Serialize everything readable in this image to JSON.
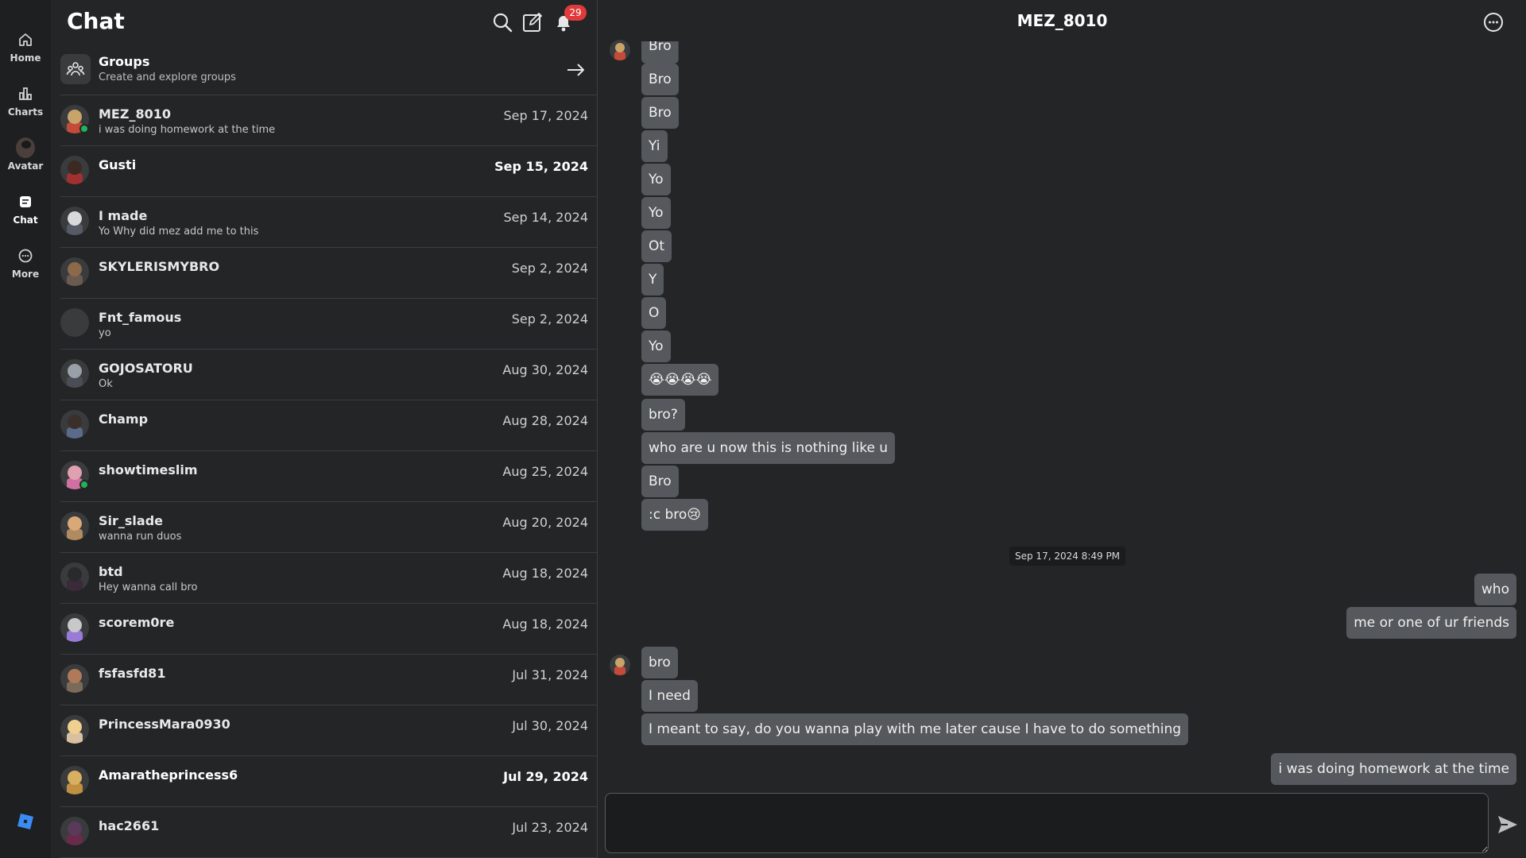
{
  "nav": {
    "items": [
      {
        "label": "Home",
        "icon": "home-icon"
      },
      {
        "label": "Charts",
        "icon": "bar-chart-icon"
      },
      {
        "label": "Avatar",
        "icon": "avatar-icon"
      },
      {
        "label": "Chat",
        "icon": "chat-icon"
      },
      {
        "label": "More",
        "icon": "more-circle-icon"
      }
    ]
  },
  "list": {
    "title": "Chat",
    "notification_count": "29",
    "groups": {
      "title": "Groups",
      "subtitle": "Create and explore groups"
    },
    "conversations": [
      {
        "name": "MEZ_8010",
        "preview": "i was doing homework at the time",
        "date": "Sep 17, 2024"
      },
      {
        "name": "Gusti",
        "preview": "",
        "date": "Sep 15, 2024"
      },
      {
        "name": "I made",
        "preview": "Yo Why did mez add me to this",
        "date": "Sep 14, 2024"
      },
      {
        "name": "SKYLERISMYBRO",
        "preview": "",
        "date": "Sep 2, 2024"
      },
      {
        "name": "Fnt_famous",
        "preview": "yo",
        "date": "Sep 2, 2024"
      },
      {
        "name": "GOJOSATORU",
        "preview": "Ok",
        "date": "Aug 30, 2024"
      },
      {
        "name": "Champ",
        "preview": "",
        "date": "Aug 28, 2024"
      },
      {
        "name": "showtimeslim",
        "preview": "",
        "date": "Aug 25, 2024"
      },
      {
        "name": "Sir_slade",
        "preview": "wanna run duos",
        "date": "Aug 20, 2024"
      },
      {
        "name": "btd",
        "preview": "Hey wanna call bro",
        "date": "Aug 18, 2024"
      },
      {
        "name": "scorem0re",
        "preview": "",
        "date": "Aug 18, 2024"
      },
      {
        "name": "fsfasfd81",
        "preview": "",
        "date": "Jul 31, 2024"
      },
      {
        "name": "PrincessMara0930",
        "preview": "",
        "date": "Jul 30, 2024"
      },
      {
        "name": "Amaratheprincess6",
        "preview": "",
        "date": "Jul 29, 2024"
      },
      {
        "name": "hac2661",
        "preview": "",
        "date": "Jul 23, 2024"
      }
    ]
  },
  "conversation": {
    "title": "MEZ_8010",
    "messages": [
      {
        "text": "Bro",
        "dir": "in"
      },
      {
        "text": "Bro",
        "dir": "in"
      },
      {
        "text": "Bro",
        "dir": "in"
      },
      {
        "text": "Yi",
        "dir": "in"
      },
      {
        "text": "Yo",
        "dir": "in"
      },
      {
        "text": "Yo",
        "dir": "in"
      },
      {
        "text": "Ot",
        "dir": "in"
      },
      {
        "text": "Y",
        "dir": "in"
      },
      {
        "text": "O",
        "dir": "in"
      },
      {
        "text": "Yo",
        "dir": "in"
      },
      {
        "text": "😭😭😭😭",
        "dir": "in"
      },
      {
        "text": "bro?",
        "dir": "in"
      },
      {
        "text": "who are u now this is nothing like u",
        "dir": "in"
      },
      {
        "text": "Bro",
        "dir": "in"
      },
      {
        "text": ":c bro😢",
        "dir": "in"
      },
      {
        "text": "who",
        "dir": "out"
      },
      {
        "text": "me or one of ur friends",
        "dir": "out"
      },
      {
        "text": "bro",
        "dir": "in"
      },
      {
        "text": "I need",
        "dir": "in"
      },
      {
        "text": "I meant to say, do you wanna play with me later cause I have to do something",
        "dir": "in"
      },
      {
        "text": "i was doing homework at the time",
        "dir": "out"
      }
    ],
    "date_divider": "Sep 17, 2024 8:49 PM",
    "composer_placeholder": ""
  }
}
